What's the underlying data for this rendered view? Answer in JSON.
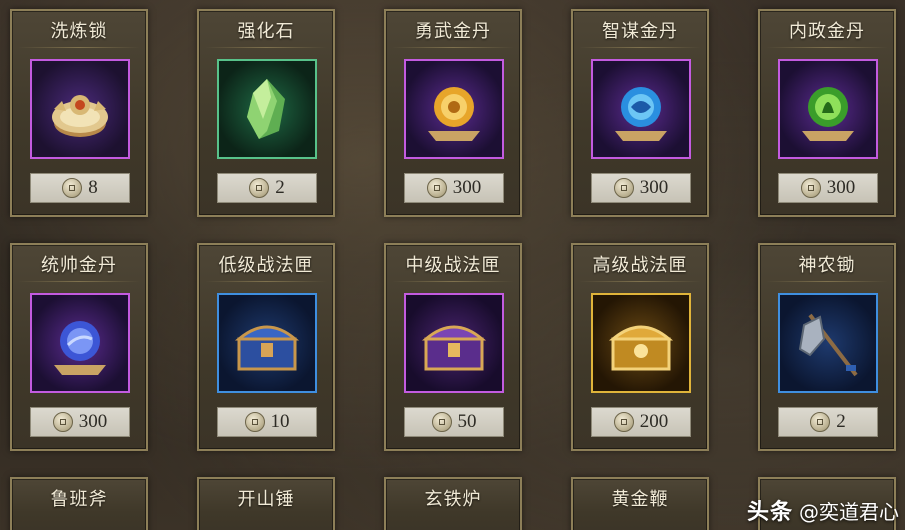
{
  "shop": {
    "items": [
      {
        "name": "洗炼锁",
        "price": "8",
        "icon": "lock-charm-icon",
        "frame": "#c35be0"
      },
      {
        "name": "强化石",
        "price": "2",
        "icon": "green-crystal-icon",
        "frame": "#58c28a"
      },
      {
        "name": "勇武金丹",
        "price": "300",
        "icon": "gold-orb-icon",
        "frame": "#c35be0"
      },
      {
        "name": "智谋金丹",
        "price": "300",
        "icon": "blue-orb-icon",
        "frame": "#c35be0"
      },
      {
        "name": "内政金丹",
        "price": "300",
        "icon": "green-orb-icon",
        "frame": "#c35be0"
      },
      {
        "name": "统帅金丹",
        "price": "300",
        "icon": "violet-orb-icon",
        "frame": "#c35be0"
      },
      {
        "name": "低级战法匣",
        "price": "10",
        "icon": "blue-chest-icon",
        "frame": "#3f8fe0"
      },
      {
        "name": "中级战法匣",
        "price": "50",
        "icon": "purple-chest-icon",
        "frame": "#c35be0"
      },
      {
        "name": "高级战法匣",
        "price": "200",
        "icon": "gold-chest-icon",
        "frame": "#e0b43a"
      },
      {
        "name": "神农锄",
        "price": "2",
        "icon": "hoe-icon",
        "frame": "#3f8fe0"
      },
      {
        "name": "鲁班斧",
        "price": "",
        "icon": "",
        "frame": ""
      },
      {
        "name": "开山锤",
        "price": "",
        "icon": "",
        "frame": ""
      },
      {
        "name": "玄铁炉",
        "price": "",
        "icon": "",
        "frame": ""
      },
      {
        "name": "黄金鞭",
        "price": "",
        "icon": "",
        "frame": ""
      }
    ]
  },
  "watermark": {
    "brand": "头条",
    "author": "@奕道君心"
  }
}
